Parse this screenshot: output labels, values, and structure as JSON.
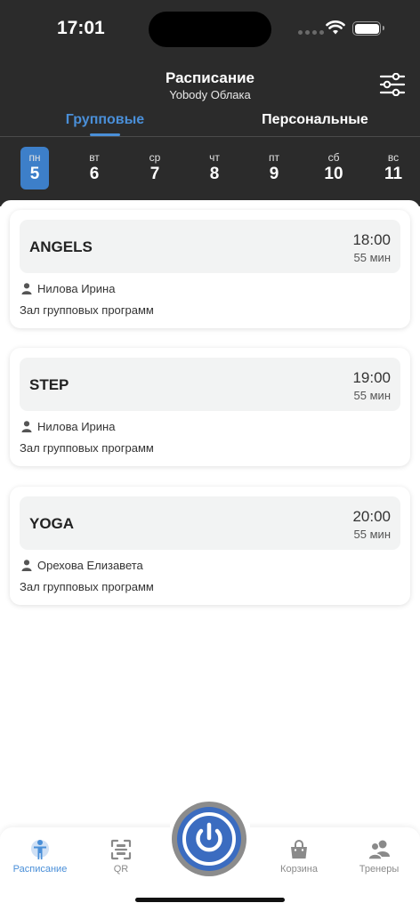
{
  "status_bar": {
    "time": "17:01"
  },
  "header": {
    "title": "Расписание",
    "subtitle": "Yobody Облака",
    "filter_icon": "sliders-icon"
  },
  "tabs": [
    {
      "label": "Групповые",
      "active": true
    },
    {
      "label": "Персональные",
      "active": false
    }
  ],
  "days": [
    {
      "weekday": "пн",
      "number": "5",
      "active": true
    },
    {
      "weekday": "вт",
      "number": "6",
      "active": false
    },
    {
      "weekday": "ср",
      "number": "7",
      "active": false
    },
    {
      "weekday": "чт",
      "number": "8",
      "active": false
    },
    {
      "weekday": "пт",
      "number": "9",
      "active": false
    },
    {
      "weekday": "сб",
      "number": "10",
      "active": false
    },
    {
      "weekday": "вс",
      "number": "11",
      "active": false
    }
  ],
  "classes": [
    {
      "name": "ANGELS",
      "time": "18:00",
      "duration": "55 мин",
      "trainer": "Нилова Ирина",
      "hall": "Зал групповых программ"
    },
    {
      "name": "STEP",
      "time": "19:00",
      "duration": "55 мин",
      "trainer": "Нилова Ирина",
      "hall": "Зал групповых программ"
    },
    {
      "name": "YOGA",
      "time": "20:00",
      "duration": "55 мин",
      "trainer": "Орехова Елизавета",
      "hall": "Зал групповых программ"
    }
  ],
  "tabbar": {
    "items": [
      {
        "label": "Расписание",
        "icon": "person-schedule-icon",
        "active": true
      },
      {
        "label": "QR",
        "icon": "qr-scan-icon",
        "active": false
      },
      {
        "label": "Корзина",
        "icon": "basket-icon",
        "active": false
      },
      {
        "label": "Тренеры",
        "icon": "trainers-icon",
        "active": false
      }
    ],
    "center_icon": "power-icon"
  },
  "colors": {
    "accent": "#4a8fd8",
    "header_bg": "#2b2b2b",
    "active_day": "#3d7fc9",
    "power_button": "#3b6cc0"
  }
}
